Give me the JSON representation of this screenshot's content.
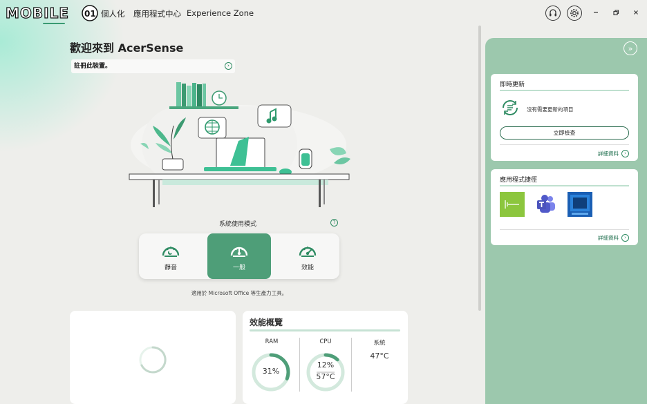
{
  "header": {
    "logo_text": "MOBILE01",
    "nav": [
      "個人化",
      "應用程式中心",
      "Experience Zone"
    ],
    "icons": [
      "headset-icon",
      "settings-gear-icon"
    ],
    "window_controls": [
      "minimize",
      "restore",
      "close"
    ]
  },
  "main": {
    "welcome_title": "歡迎來到 AcerSense",
    "register_label": "註冊此裝置。",
    "mode_label": "系統使用模式",
    "modes": [
      {
        "label": "靜音",
        "active": false
      },
      {
        "label": "一般",
        "active": true
      },
      {
        "label": "效能",
        "active": false
      }
    ],
    "mode_description": "適用於 Microsoft Office 等生產力工具。"
  },
  "performance": {
    "title": "效能概覽",
    "ram_label": "RAM",
    "ram_value": "31%",
    "ram_fraction": 0.31,
    "cpu_label": "CPU",
    "cpu_usage": "12%",
    "cpu_temp": "57°C",
    "cpu_fraction": 0.12,
    "system_label": "系統",
    "system_temp": "47°C"
  },
  "sidebar": {
    "updates": {
      "title": "即時更新",
      "status": "沒有需要更新的項目",
      "check_button": "立即檢查",
      "details_link": "詳細資料"
    },
    "shortcuts": {
      "title": "應用程式捷徑",
      "apps": [
        "acer-purified-voice-app-icon",
        "microsoft-teams-app-icon",
        "acer-app-icon"
      ],
      "details_link": "詳細資料"
    }
  },
  "colors": {
    "accent": "#4e9e78",
    "sidebar_bg": "#9cc8ad",
    "background": "#eeeeeb"
  }
}
